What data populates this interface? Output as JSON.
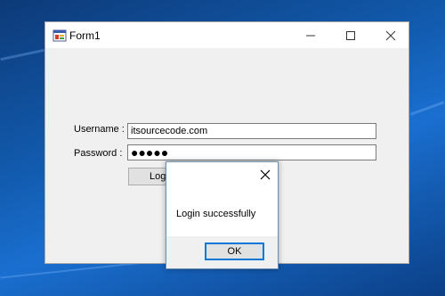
{
  "window": {
    "title": "Form1",
    "username_label": "Username :",
    "username_value": "itsourcecode.com",
    "password_label": "Password :",
    "password_value": "●●●●●",
    "login_button": "Login"
  },
  "message_box": {
    "text": "Login successfully",
    "ok_button": "OK"
  },
  "icons": {
    "app": "form-app-icon",
    "minimize": "minimize-icon",
    "maximize": "maximize-icon",
    "close": "close-icon",
    "msg_close": "close-icon"
  },
  "colors": {
    "desktop": "#125cb0",
    "window_bg": "#f0f0f0",
    "focus_border": "#0078d7"
  }
}
